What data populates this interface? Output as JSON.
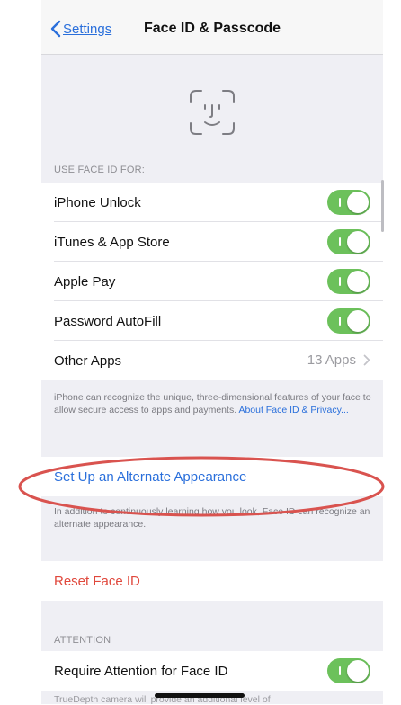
{
  "nav": {
    "back_label": "Settings",
    "title": "Face ID & Passcode"
  },
  "use_face_id": {
    "header": "USE FACE ID FOR:",
    "items": [
      {
        "label": "iPhone Unlock",
        "enabled": true
      },
      {
        "label": "iTunes & App Store",
        "enabled": true
      },
      {
        "label": "Apple Pay",
        "enabled": true
      },
      {
        "label": "Password AutoFill",
        "enabled": true
      }
    ],
    "other_apps": {
      "label": "Other Apps",
      "value": "13 Apps"
    },
    "footnote": "iPhone can recognize the unique, three-dimensional features of your face to allow secure access to apps and payments.",
    "footnote_link": "About Face ID & Privacy..."
  },
  "alternate": {
    "label": "Set Up an Alternate Appearance",
    "footnote": "In addition to continuously learning how you look, Face ID can recognize an alternate appearance."
  },
  "reset": {
    "label": "Reset Face ID"
  },
  "attention": {
    "header": "ATTENTION",
    "require_label": "Require Attention for Face ID",
    "require_enabled": true,
    "footnote_partial": "TrueDepth camera will provide an additional level of"
  },
  "colors": {
    "link_blue": "#2a6fdb",
    "toggle_green": "#6cc15b",
    "destructive_red": "#e0483c",
    "highlight_ellipse": "#d9534f"
  },
  "icons": {
    "back": "chevron-left-icon",
    "face_id": "face-id-icon",
    "disclosure": "chevron-right-icon"
  }
}
